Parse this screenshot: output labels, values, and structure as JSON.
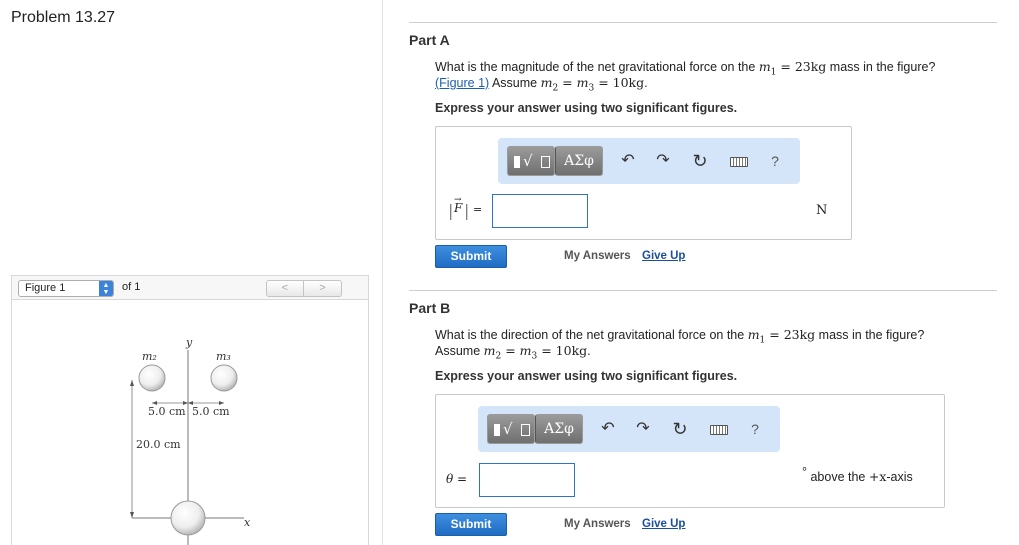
{
  "problem": {
    "title": "Problem 13.27"
  },
  "figure_panel": {
    "select_value": "Figure 1",
    "of_label": "of 1",
    "prev_glyph": "<",
    "next_glyph": ">",
    "labels": {
      "y_axis": "y",
      "x_axis": "x",
      "m1": "m₁",
      "m2": "m₂",
      "m3": "m₃",
      "dist_left": "5.0 cm",
      "dist_right": "5.0 cm",
      "dist_vertical": "20.0 cm"
    }
  },
  "toolbar": {
    "greek_label": "ΑΣφ",
    "help_label": "?",
    "icons": [
      "templates-icon",
      "greek-icon",
      "undo-icon",
      "redo-icon",
      "reset-icon",
      "keyboard-icon",
      "help-icon"
    ]
  },
  "part_a": {
    "title": "Part A",
    "question_pre": "What is the magnitude of the net gravitational force on the ",
    "question_m1": "m",
    "question_m1_sub": "1",
    "question_eq": " = 23",
    "question_unit": "kg",
    "question_post": " mass in the figure?",
    "figure_link": "(Figure 1)",
    "assume_pre": " Assume ",
    "assume_expr_m2": "m",
    "assume_expr_m2_sub": "2",
    "assume_eq1": " = ",
    "assume_expr_m3": "m",
    "assume_expr_m3_sub": "3",
    "assume_eq2": " = 10",
    "assume_unit": "kg",
    "assume_end": ".",
    "instruction": "Express your answer using two significant figures.",
    "lhs_label": "F",
    "eq_sign": "=",
    "input_value": "",
    "unit": "N",
    "submit_label": "Submit",
    "my_answers_label": "My Answers",
    "give_up_label": "Give Up"
  },
  "part_b": {
    "title": "Part B",
    "question_pre": "What is the direction of the net gravitational force on the ",
    "question_m1": "m",
    "question_m1_sub": "1",
    "question_eq": " = 23",
    "question_unit": "kg",
    "question_post": " mass in the figure?",
    "assume_pre": "Assume ",
    "assume_expr_m2": "m",
    "assume_expr_m2_sub": "2",
    "assume_eq1": " = ",
    "assume_expr_m3": "m",
    "assume_expr_m3_sub": "3",
    "assume_eq2": " = 10",
    "assume_unit": "kg",
    "assume_end": ".",
    "instruction": "Express your answer using two significant figures.",
    "lhs_label": "θ =",
    "input_value": "",
    "unit_degree": "°",
    "unit_text_pre": " above the ",
    "unit_axis": "+x",
    "unit_text_post": "-axis",
    "submit_label": "Submit",
    "my_answers_label": "My Answers",
    "give_up_label": "Give Up"
  },
  "colors": {
    "toolbar_bg": "#d4e5fa",
    "submit_blue": "#1e6cc4",
    "input_border": "#2f74c7",
    "link_blue": "#1b5fb5"
  }
}
